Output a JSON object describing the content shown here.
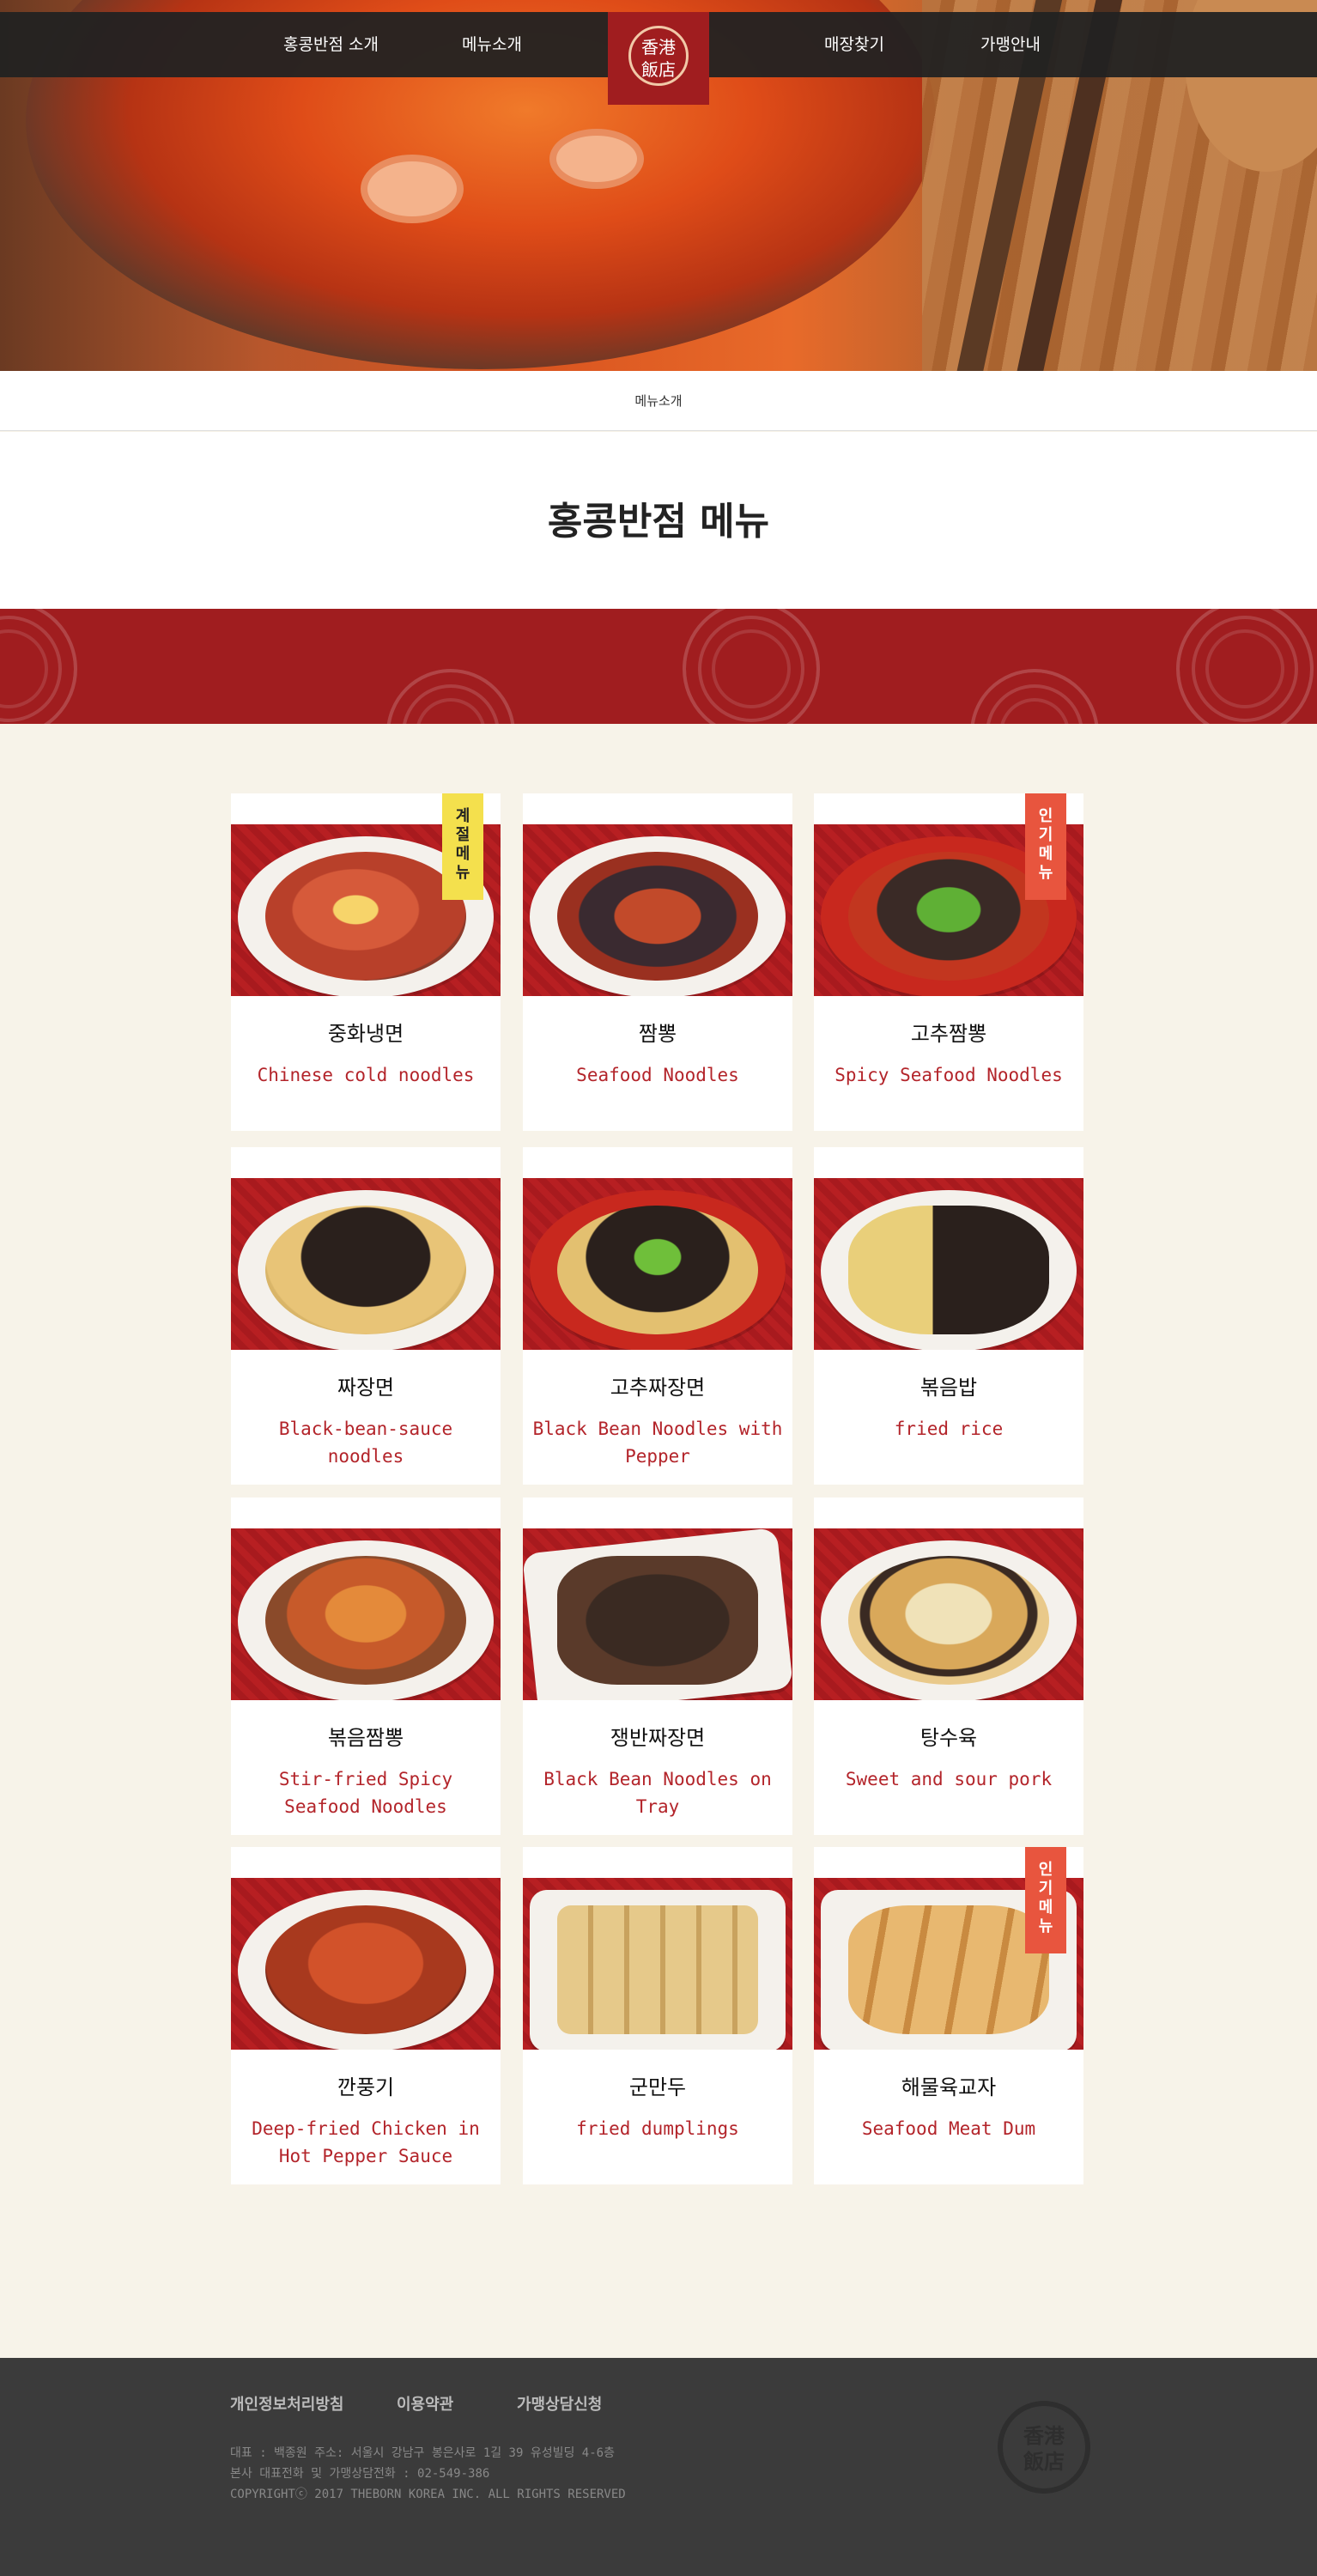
{
  "nav": {
    "items": [
      "홍콩반점 소개",
      "메뉴소개",
      "매장찾기",
      "가맹안내"
    ],
    "logo_text": [
      "香港",
      "飯店"
    ]
  },
  "breadcrumb": "메뉴소개",
  "page_title": "홍콩반점 메뉴",
  "menu": [
    {
      "kr": "중화냉면",
      "en": "Chinese cold noodles",
      "badge": "계절메뉴",
      "badge_color": "#f4e04d"
    },
    {
      "kr": "짬뽕",
      "en": "Seafood Noodles",
      "badge": "",
      "badge_color": ""
    },
    {
      "kr": "고추짬뽕",
      "en": "Spicy Seafood Noodles",
      "badge": "인기메뉴",
      "badge_color": "#e8553e"
    },
    {
      "kr": "짜장면",
      "en": "Black-bean-sauce noodles",
      "badge": "",
      "badge_color": ""
    },
    {
      "kr": "고추짜장면",
      "en": "Black Bean Noodles with Pepper",
      "badge": "",
      "badge_color": ""
    },
    {
      "kr": "볶음밥",
      "en": "fried rice",
      "badge": "",
      "badge_color": ""
    },
    {
      "kr": "볶음짬뽕",
      "en": "Stir-fried Spicy Seafood Noodles",
      "badge": "",
      "badge_color": ""
    },
    {
      "kr": "쟁반짜장면",
      "en": "Black Bean Noodles on Tray",
      "badge": "",
      "badge_color": ""
    },
    {
      "kr": "탕수육",
      "en": "Sweet and sour pork",
      "badge": "",
      "badge_color": ""
    },
    {
      "kr": "깐풍기",
      "en": "Deep-fried Chicken in Hot Pepper Sauce",
      "badge": "",
      "badge_color": ""
    },
    {
      "kr": "군만두",
      "en": "fried dumplings",
      "badge": "",
      "badge_color": ""
    },
    {
      "kr": "해물육교자",
      "en": "Seafood Meat Dum",
      "badge": "인기메뉴",
      "badge_color": "#e8553e"
    }
  ],
  "footer": {
    "links": [
      "개인정보처리방침",
      "이용약관",
      "가맹상담신청"
    ],
    "address": "대표 : 백종원  주소: 서울시 강남구 봉은사로 1길 39 유성빌딩 4-6층",
    "phone": "본사 대표전화 및 가맹상담전화 : 02-549-386",
    "copyright": "COPYRIGHTⓒ 2017 THEBORN KOREA INC. ALL RIGHTS RESERVED",
    "logo_text": [
      "香港",
      "飯店"
    ]
  },
  "colors": {
    "brand_red": "#a01d1f",
    "menu_text_red": "#b3242a",
    "footer_bg": "#3b3b3b",
    "page_bg": "#f7f3e9"
  }
}
